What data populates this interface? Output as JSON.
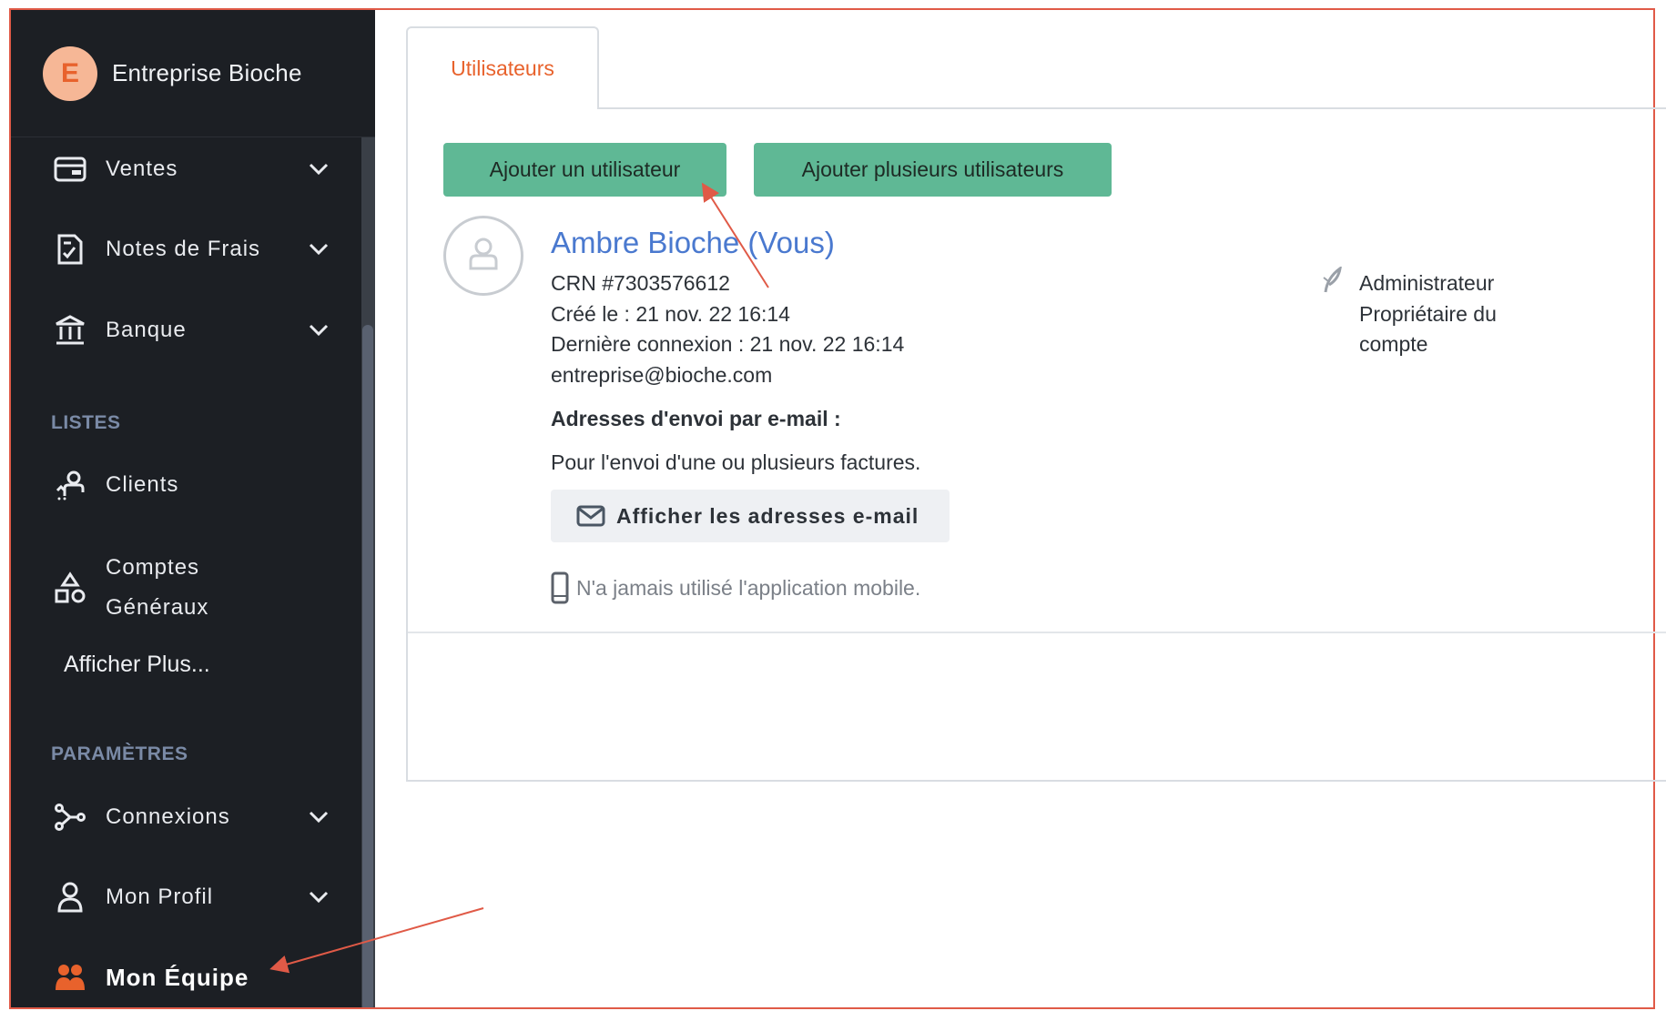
{
  "company": {
    "initial": "E",
    "name": "Entreprise Bioche"
  },
  "sidebar": {
    "items": [
      {
        "label": "Ventes",
        "icon": "wallet-icon",
        "has_chevron": true
      },
      {
        "label": "Notes de Frais",
        "icon": "receipt-icon",
        "has_chevron": true
      },
      {
        "label": "Banque",
        "icon": "bank-icon",
        "has_chevron": true
      }
    ],
    "section_lists": "LISTES",
    "list_items": [
      {
        "label": "Clients",
        "icon": "clients-icon"
      },
      {
        "label_line1": "Comptes",
        "label_line2": "Généraux",
        "icon": "shapes-icon"
      }
    ],
    "show_more": "Afficher Plus...",
    "section_settings": "PARAMÈTRES",
    "settings_items": [
      {
        "label": "Connexions",
        "icon": "connections-icon",
        "has_chevron": true
      },
      {
        "label": "Mon Profil",
        "icon": "profile-icon",
        "has_chevron": true
      },
      {
        "label": "Mon Équipe",
        "icon": "team-icon",
        "active": true
      }
    ]
  },
  "tabs": {
    "active": "Utilisateurs"
  },
  "actions": {
    "add_user": "Ajouter un utilisateur",
    "add_many_users": "Ajouter plusieurs utilisateurs"
  },
  "user": {
    "name": "Ambre Bioche (Vous)",
    "crn": "CRN #7303576612",
    "created": "Créé le : 21 nov. 22 16:14",
    "last_login": "Dernière connexion : 21 nov. 22 16:14",
    "email": "entreprise@bioche.com",
    "email_section_title": "Adresses d'envoi par e-mail :",
    "email_section_desc": "Pour l'envoi d'une ou plusieurs factures.",
    "show_emails_button": "Afficher les adresses e-mail",
    "mobile_note": "N'a jamais utilisé l'application mobile.",
    "role_line1": "Administrateur",
    "role_line2": "Propriétaire du",
    "role_line3": "compte"
  },
  "colors": {
    "accent": "#e8622c",
    "button_green": "#5fb895",
    "link_blue": "#4a79cf",
    "sidebar_bg": "#1c1f24",
    "annotation_red": "#e05a47"
  }
}
